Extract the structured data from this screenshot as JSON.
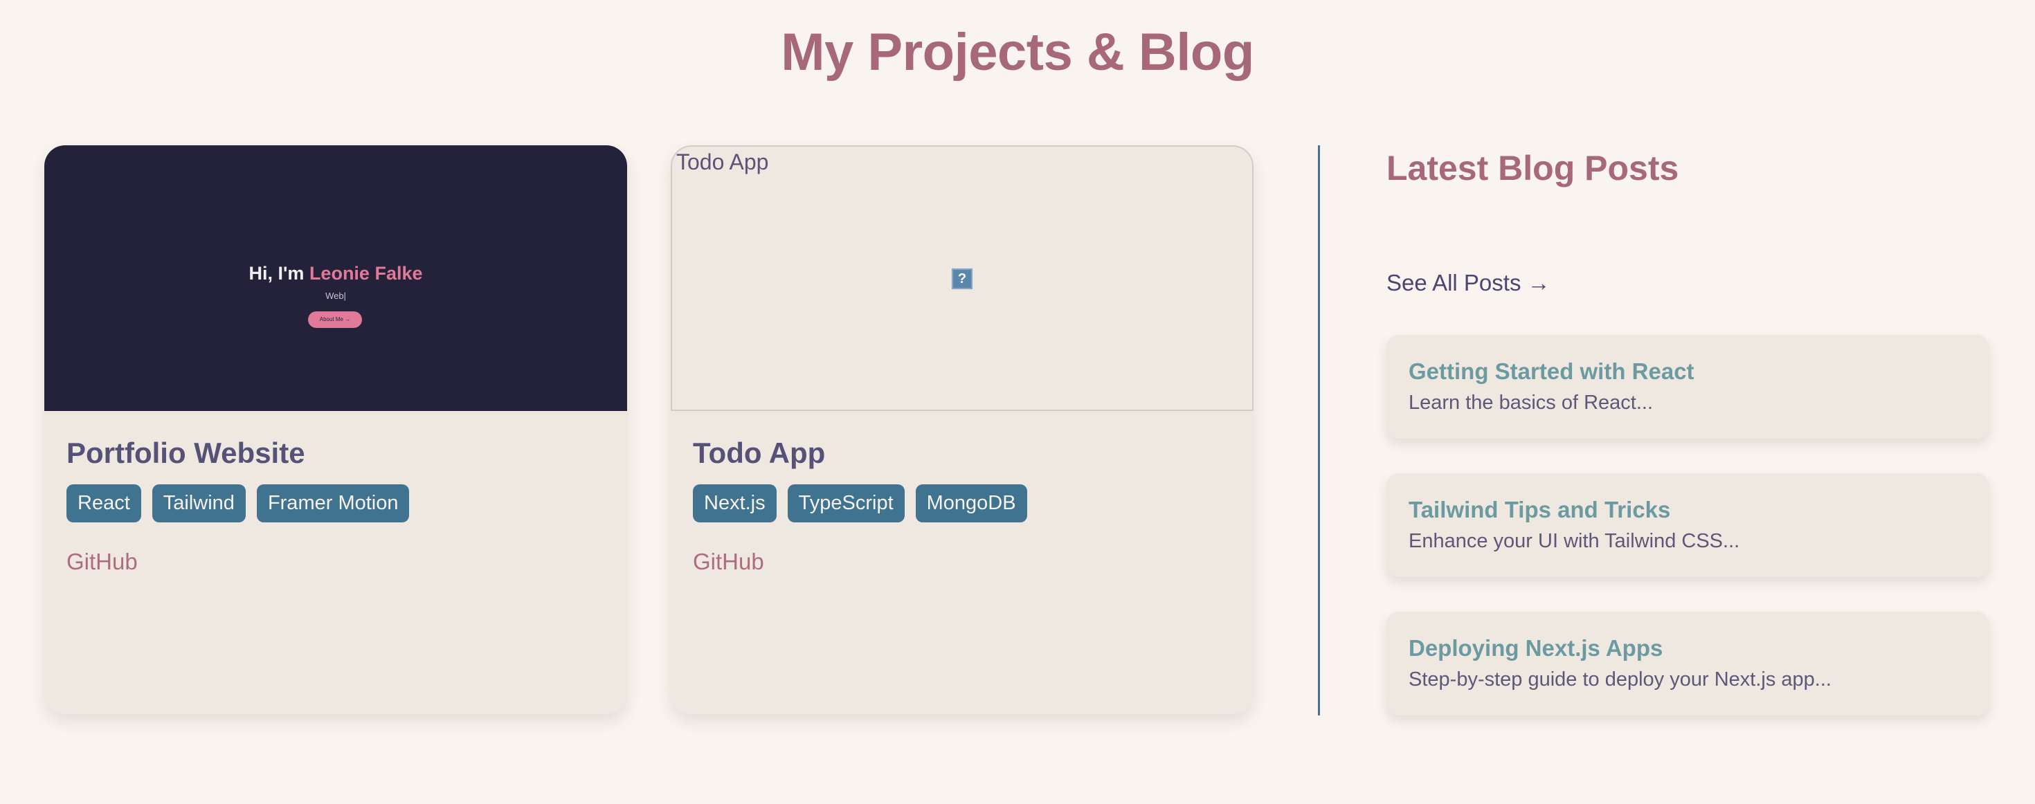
{
  "header": {
    "title": "My Projects & Blog"
  },
  "projects": [
    {
      "title": "Portfolio Website",
      "preview": {
        "greeting": "Hi, I'm",
        "name": "Leonie Falke",
        "subtitle": "Web|",
        "button_label": "About Me →"
      },
      "tags": [
        "React",
        "Tailwind",
        "Framer Motion"
      ],
      "link_label": "GitHub"
    },
    {
      "title": "Todo App",
      "image_alt": "Todo App",
      "broken_image_glyph": "?",
      "tags": [
        "Next.js",
        "TypeScript",
        "MongoDB"
      ],
      "link_label": "GitHub"
    }
  ],
  "blog": {
    "heading": "Latest Blog Posts",
    "see_all_label": "See All Posts →",
    "posts": [
      {
        "title": "Getting Started with React",
        "excerpt": "Learn the basics of React..."
      },
      {
        "title": "Tailwind Tips and Tricks",
        "excerpt": "Enhance your UI with Tailwind CSS..."
      },
      {
        "title": "Deploying Next.js Apps",
        "excerpt": "Step-by-step guide to deploy your Next.js app..."
      }
    ]
  },
  "colors": {
    "background": "#f9f4ef",
    "accent_rose": "#a6687a",
    "tag_blue": "#3f7390",
    "card_bg": "#efe8e0",
    "preview_dark": "#24213a",
    "preview_pink": "#e07a98",
    "post_title_teal": "#6b9aa0"
  }
}
